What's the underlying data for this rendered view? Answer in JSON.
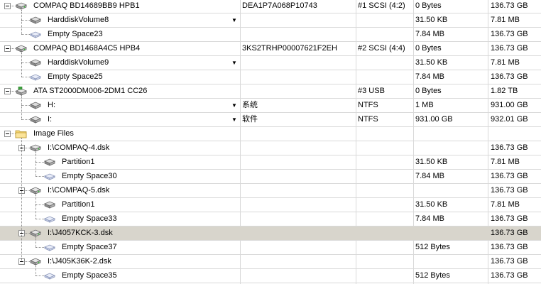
{
  "rows": [
    {
      "label": "COMPAQ BD14689BB9 HPB1",
      "serial": "DEA1P7A068P10743",
      "bus": "#1 SCSI (4:2)",
      "size1": "0 Bytes",
      "size2": "136.73 GB",
      "icon": "hard-disk-icon",
      "level": 0,
      "toggle": true,
      "dropdown": false,
      "selected": false
    },
    {
      "label": "HarddiskVolume8",
      "serial": "",
      "bus": "",
      "size1": "31.50 KB",
      "size2": "7.81 MB",
      "icon": "volume-icon",
      "level": 1,
      "toggle": false,
      "dropdown": true,
      "selected": false
    },
    {
      "label": "Empty Space23",
      "serial": "",
      "bus": "",
      "size1": "7.84 MB",
      "size2": "136.73 GB",
      "icon": "empty-space-icon",
      "level": 1,
      "toggle": false,
      "dropdown": false,
      "selected": false
    },
    {
      "label": "COMPAQ BD1468A4C5 HPB4",
      "serial": "3KS2TRHP00007621F2EH",
      "bus": "#2 SCSI (4:4)",
      "size1": "0 Bytes",
      "size2": "136.73 GB",
      "icon": "hard-disk-icon",
      "level": 0,
      "toggle": true,
      "dropdown": false,
      "selected": false
    },
    {
      "label": "HarddiskVolume9",
      "serial": "",
      "bus": "",
      "size1": "31.50 KB",
      "size2": "7.81 MB",
      "icon": "volume-icon",
      "level": 1,
      "toggle": false,
      "dropdown": true,
      "selected": false
    },
    {
      "label": "Empty Space25",
      "serial": "",
      "bus": "",
      "size1": "7.84 MB",
      "size2": "136.73 GB",
      "icon": "empty-space-icon",
      "level": 1,
      "toggle": false,
      "dropdown": false,
      "selected": false
    },
    {
      "label": "ATA ST2000DM006-2DM1 CC26",
      "serial": "",
      "bus": "#3 USB",
      "size1": "0 Bytes",
      "size2": "1.82 TB",
      "icon": "usb-disk-icon",
      "level": 0,
      "toggle": true,
      "dropdown": false,
      "selected": false
    },
    {
      "label": "H:",
      "serial": "系统",
      "bus": "NTFS",
      "size1": "1 MB",
      "size2": "931.00 GB",
      "icon": "volume-icon",
      "level": 1,
      "toggle": false,
      "dropdown": true,
      "selected": false
    },
    {
      "label": "I:",
      "serial": "软件",
      "bus": "NTFS",
      "size1": "931.00 GB",
      "size2": "932.01 GB",
      "icon": "volume-icon",
      "level": 1,
      "toggle": false,
      "dropdown": true,
      "selected": false
    },
    {
      "label": "Image Files",
      "serial": "",
      "bus": "",
      "size1": "",
      "size2": "",
      "icon": "folder-icon",
      "level": 0,
      "toggle": true,
      "dropdown": false,
      "selected": false
    },
    {
      "label": "I:\\COMPAQ-4.dsk",
      "serial": "",
      "bus": "",
      "size1": "",
      "size2": "136.73 GB",
      "icon": "hard-disk-icon",
      "level": 1,
      "toggle": true,
      "dropdown": false,
      "selected": false
    },
    {
      "label": "Partition1",
      "serial": "",
      "bus": "",
      "size1": "31.50 KB",
      "size2": "7.81 MB",
      "icon": "volume-icon",
      "level": 2,
      "toggle": false,
      "dropdown": false,
      "selected": false
    },
    {
      "label": "Empty Space30",
      "serial": "",
      "bus": "",
      "size1": "7.84 MB",
      "size2": "136.73 GB",
      "icon": "empty-space-icon",
      "level": 2,
      "toggle": false,
      "dropdown": false,
      "selected": false
    },
    {
      "label": "I:\\COMPAQ-5.dsk",
      "serial": "",
      "bus": "",
      "size1": "",
      "size2": "136.73 GB",
      "icon": "hard-disk-icon",
      "level": 1,
      "toggle": true,
      "dropdown": false,
      "selected": false
    },
    {
      "label": "Partition1",
      "serial": "",
      "bus": "",
      "size1": "31.50 KB",
      "size2": "7.81 MB",
      "icon": "volume-icon",
      "level": 2,
      "toggle": false,
      "dropdown": false,
      "selected": false
    },
    {
      "label": "Empty Space33",
      "serial": "",
      "bus": "",
      "size1": "7.84 MB",
      "size2": "136.73 GB",
      "icon": "empty-space-icon",
      "level": 2,
      "toggle": false,
      "dropdown": false,
      "selected": false
    },
    {
      "label": "I:\\J4057KCK-3.dsk",
      "serial": "",
      "bus": "",
      "size1": "",
      "size2": "136.73 GB",
      "icon": "hard-disk-icon",
      "level": 1,
      "toggle": true,
      "dropdown": false,
      "selected": true
    },
    {
      "label": "Empty Space37",
      "serial": "",
      "bus": "",
      "size1": "512 Bytes",
      "size2": "136.73 GB",
      "icon": "empty-space-icon",
      "level": 2,
      "toggle": false,
      "dropdown": false,
      "selected": false
    },
    {
      "label": "I:\\J405K36K-2.dsk",
      "serial": "",
      "bus": "",
      "size1": "",
      "size2": "136.73 GB",
      "icon": "hard-disk-icon",
      "level": 1,
      "toggle": true,
      "dropdown": false,
      "selected": false
    },
    {
      "label": "Empty Space35",
      "serial": "",
      "bus": "",
      "size1": "512 Bytes",
      "size2": "136.73 GB",
      "icon": "empty-space-icon",
      "level": 2,
      "toggle": false,
      "dropdown": false,
      "selected": false
    }
  ]
}
